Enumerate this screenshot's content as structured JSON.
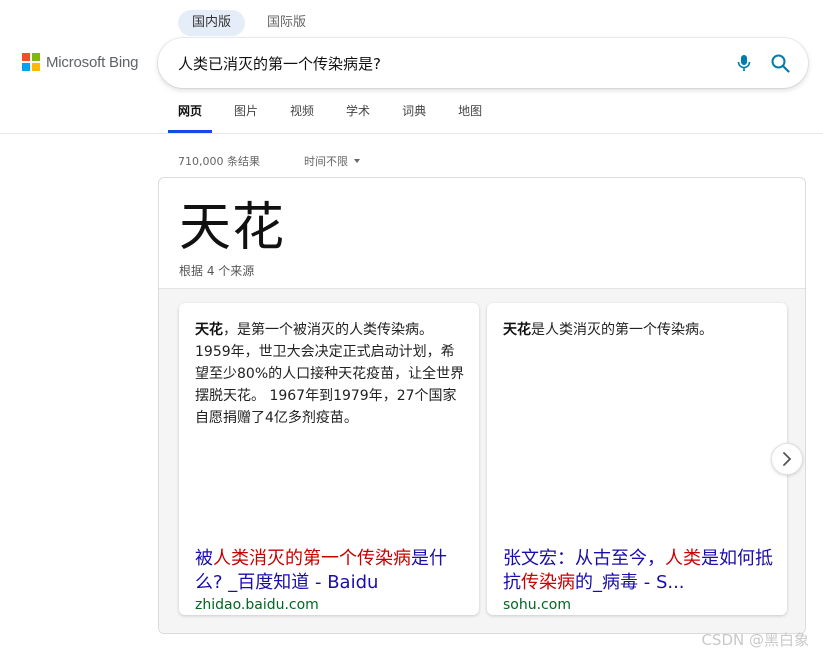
{
  "region_tabs": [
    {
      "label": "国内版",
      "active": true
    },
    {
      "label": "国际版",
      "active": false
    }
  ],
  "logo": {
    "text": "Microsoft Bing",
    "colors": [
      "#f25022",
      "#7fba00",
      "#00a4ef",
      "#ffb900"
    ]
  },
  "search": {
    "value": "人类已消灭的第一个传染病是?",
    "mic_icon": "mic-icon",
    "search_icon": "search-icon",
    "accent": "#007daa"
  },
  "scope_tabs": [
    {
      "label": "网页",
      "active": true
    },
    {
      "label": "图片",
      "active": false
    },
    {
      "label": "视频",
      "active": false
    },
    {
      "label": "学术",
      "active": false
    },
    {
      "label": "词典",
      "active": false
    },
    {
      "label": "地图",
      "active": false
    }
  ],
  "results_meta": {
    "count": "710,000 条结果",
    "time_filter": "时间不限"
  },
  "answer": {
    "title": "天花",
    "subtitle": "根据 4 个来源",
    "cards": [
      {
        "snippet_bold": "天花",
        "snippet_rest": "，是第一个被消灭的人类传染病。 1959年，世卫大会决定正式启动计划，希望至少80%的人口接种天花疫苗，让全世界摆脱天花。 1967年到1979年，27个国家自愿捐赠了4亿多剂疫苗。",
        "link_pre": "被",
        "link_hl": "人类消灭的第一个传染病",
        "link_post": "是什么? _百度知道 - Baidu",
        "url": "zhidao.baidu.com"
      },
      {
        "snippet_bold": "天花",
        "snippet_rest": "是人类消灭的第一个传染病。",
        "link_pre": "张文宏：从古至今，",
        "link_hl": "人类",
        "link_mid": "是如何抵抗",
        "link_hl2": "传染病",
        "link_post": "的_病毒 - S...",
        "url": "sohu.com"
      }
    ]
  },
  "watermark": "CSDN @黑白象"
}
